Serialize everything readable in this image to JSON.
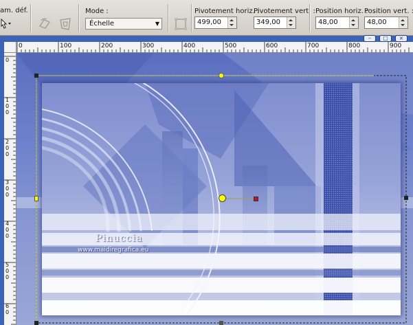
{
  "toolbar": {
    "preset_label": "am. déf. :",
    "mode_label": "Mode :",
    "mode_value": "Échelle",
    "pivot_h_label": "Pivotement horiz. :",
    "pivot_h_value": "499,00",
    "pivot_v_label": "Pivotement vert. :",
    "pivot_v_value": "349,00",
    "pos_h_label": "Position horiz. :",
    "pos_h_value": "48,00",
    "pos_v_label": "Position vert. :",
    "pos_v_value": "48,00"
  },
  "ruler": {
    "h_ticks": [
      "0",
      "100",
      "200",
      "300",
      "400",
      "500",
      "600",
      "700",
      "800",
      "900"
    ],
    "v_ticks": [
      "0",
      "1",
      "2",
      "3",
      "4",
      "5",
      "6"
    ],
    "v_sub": "0"
  },
  "image": {
    "watermark_name": "Pinuccia",
    "watermark_url": "www.maidiregrafica.eu"
  },
  "colors": {
    "window_frame": "#3d64b4",
    "handle_yellow": "#ffff00",
    "handle_red": "#c0102a"
  }
}
